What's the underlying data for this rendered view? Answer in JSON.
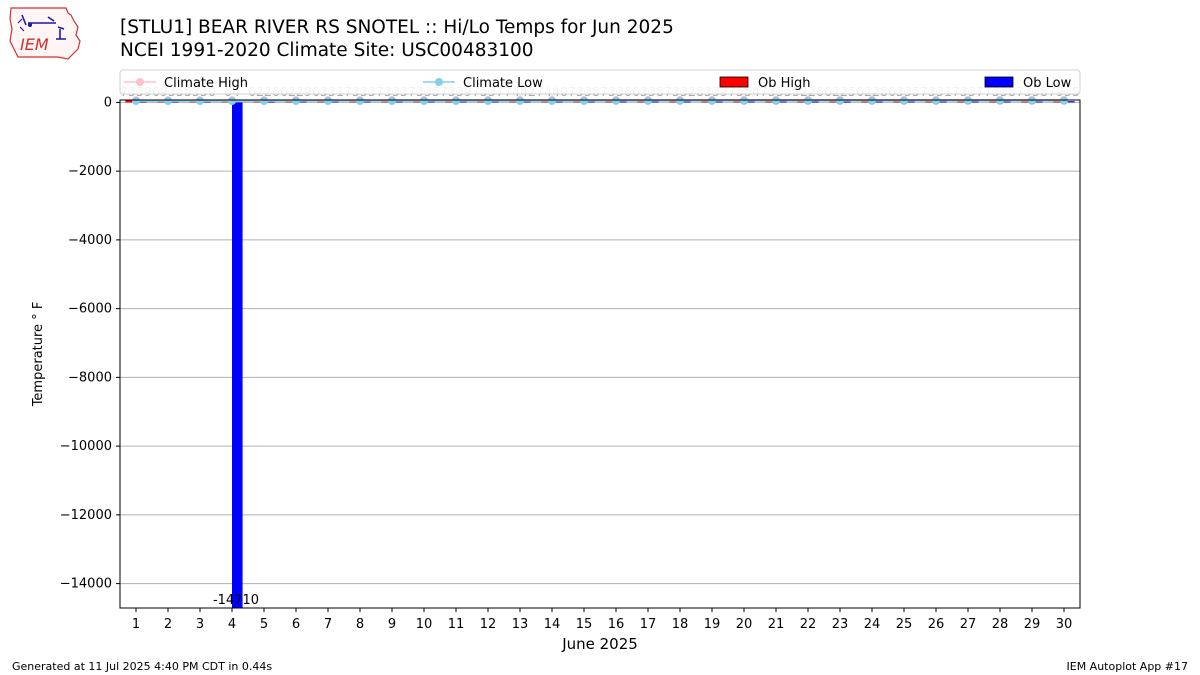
{
  "header": {
    "logo_text": "IEM",
    "title": "[STLU1] BEAR RIVER RS SNOTEL :: Hi/Lo Temps for Jun 2025",
    "subtitle": "NCEI 1991-2020 Climate Site: USC00483100"
  },
  "footer": {
    "generated": "Generated at 11 Jul 2025 4:40 PM CDT in 0.44s",
    "app": "IEM Autoplot App #17"
  },
  "colors": {
    "climate_high": "#ffc0cb",
    "climate_low": "#87ceeb",
    "ob_high": "#ff0000",
    "ob_low": "#0000ff"
  },
  "chart_data": {
    "type": "bar",
    "title": "[STLU1] BEAR RIVER RS SNOTEL :: Hi/Lo Temps for Jun 2025",
    "xlabel": "June 2025",
    "ylabel": "Temperature ° F",
    "ylim": [
      -14710,
      70
    ],
    "yticks": [
      0,
      -2000,
      -4000,
      -6000,
      -8000,
      -10000,
      -12000,
      -14000
    ],
    "ytick_labels": [
      "0",
      "−2000",
      "−4000",
      "−6000",
      "−8000",
      "−10000",
      "−12000",
      "−14000"
    ],
    "grid": true,
    "legend_position": "top",
    "categories": [
      "1",
      "2",
      "3",
      "4",
      "5",
      "6",
      "7",
      "8",
      "9",
      "10",
      "11",
      "12",
      "13",
      "14",
      "15",
      "16",
      "17",
      "18",
      "19",
      "20",
      "21",
      "22",
      "23",
      "24",
      "25",
      "26",
      "27",
      "28",
      "29",
      "30"
    ],
    "series": [
      {
        "name": "Climate High",
        "type": "line",
        "values": [
          68,
          68,
          69,
          69,
          70,
          70,
          71,
          71,
          72,
          72,
          72,
          73,
          73,
          73,
          74,
          74,
          75,
          75,
          75,
          76,
          76,
          76,
          77,
          77,
          77,
          78,
          78,
          78,
          79,
          79
        ]
      },
      {
        "name": "Climate Low",
        "type": "line",
        "values": [
          38,
          38,
          39,
          39,
          39,
          40,
          40,
          40,
          41,
          41,
          41,
          41,
          42,
          42,
          42,
          43,
          43,
          43,
          43,
          44,
          44,
          44,
          45,
          45,
          45,
          45,
          46,
          46,
          46,
          46
        ]
      },
      {
        "name": "Ob High",
        "type": "bar",
        "values": [
          73,
          69,
          53,
          64,
          62,
          62,
          63,
          73,
          73,
          73,
          73,
          75,
          74,
          74,
          73,
          73,
          63,
          73,
          83,
          75,
          73,
          52,
          62,
          62,
          63,
          73,
          73,
          73,
          73,
          79
        ]
      },
      {
        "name": "Ob Low",
        "type": "bar",
        "values": [
          39,
          35,
          30,
          -14710,
          26,
          29,
          31,
          33,
          33,
          35,
          39,
          37,
          42,
          40,
          38,
          36,
          38,
          32,
          39,
          54,
          35,
          26,
          25,
          28,
          35,
          31,
          37,
          38,
          38,
          35
        ]
      }
    ],
    "top_label_pairs": [
      [
        "73",
        "39"
      ],
      [
        "69",
        "35"
      ],
      [
        "53",
        "30"
      ],
      [
        "64",
        ""
      ],
      [
        "62",
        "26"
      ],
      [
        "62",
        "29"
      ],
      [
        "63",
        "31"
      ],
      [
        "73",
        "33"
      ],
      [
        "73",
        "33"
      ],
      [
        "73",
        "35"
      ],
      [
        "73",
        "39"
      ],
      [
        "75",
        "37"
      ],
      [
        "74",
        "42"
      ],
      [
        "74",
        "40"
      ],
      [
        "73",
        "38"
      ],
      [
        "73",
        "36"
      ],
      [
        "63",
        "38"
      ],
      [
        "73",
        "32"
      ],
      [
        "83",
        "39"
      ],
      [
        "75",
        "54"
      ],
      [
        "73",
        "35"
      ],
      [
        "52",
        "26"
      ],
      [
        "62",
        "25"
      ],
      [
        "62",
        "28"
      ],
      [
        "63",
        "35"
      ],
      [
        "73",
        "31"
      ],
      [
        "73",
        "37"
      ],
      [
        "73",
        "38"
      ],
      [
        "73",
        "38"
      ],
      [
        "79",
        "35"
      ]
    ],
    "annotations": [
      {
        "category": "4",
        "text": "-14710"
      }
    ]
  }
}
